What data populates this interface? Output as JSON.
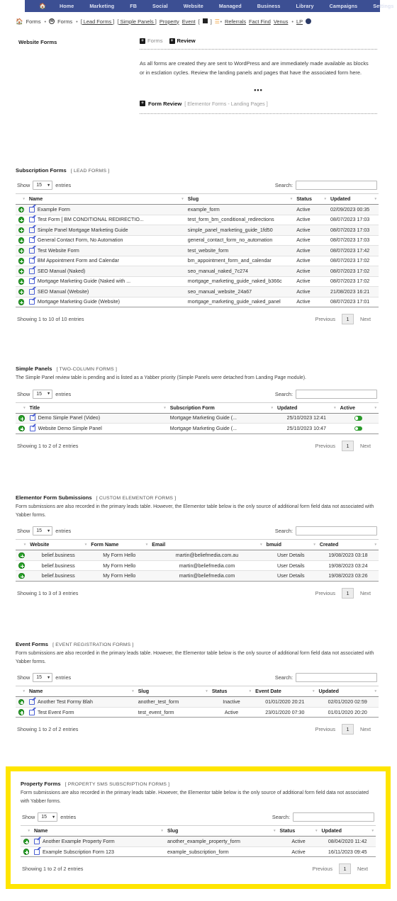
{
  "topnav": {
    "home_icon": "home-icon",
    "items": [
      "Home",
      "Marketing",
      "FB",
      "Social",
      "Website",
      "Managed",
      "Business",
      "Library",
      "Campaigns",
      "Settings"
    ],
    "bg_color": "#3c4f93"
  },
  "breadcrumb": {
    "home_icon": "home-icon",
    "item1": "Forms",
    "sep1": "•",
    "wp_icon": "wordpress-icon",
    "item2": "Forms",
    "sep2": "•",
    "item3": "[ Lead Forms ]",
    "item4": "[ Simple Panels ]",
    "item5": "Property",
    "item6": "Event",
    "item7_open": "[",
    "square_icon": "square-icon",
    "item7_close": "]",
    "list_icon": "list-icon",
    "sep3": "•",
    "item8": "Referrals",
    "item9": "Fact Find",
    "item10": "Venus",
    "sep4": "•",
    "item11": "LP",
    "moon_icon": "moon-icon"
  },
  "intro": {
    "label": "Website Forms",
    "tag_forms": "Forms",
    "tag_review": "Review",
    "paragraph": "As all forms are created they are sent to WordPress and are immediately made available as blocks or in esclation cycles. Review the landing panels and pages that have the associated form here.",
    "ellipsis": "•••",
    "review_title": "Form Review",
    "review_sub": "[ Elementor Forms  -  Landing Pages ]"
  },
  "controls": {
    "show_label": "Show",
    "entries_label": "entries",
    "page_size": "15",
    "search_label": "Search:",
    "search_value": "",
    "search_placeholder": ""
  },
  "pager": {
    "previous": "Previous",
    "page": "1",
    "next": "Next"
  },
  "sections": [
    {
      "title": "Subscription Forms",
      "tag": "[ LEAD FORMS ]",
      "desc": "",
      "columns": [
        "Name",
        "Slug",
        "Status",
        "Updated"
      ],
      "rows": [
        {
          "name": "Example Form",
          "slug": "example_form",
          "status": "Active",
          "updated": "02/09/2023 00:35"
        },
        {
          "name": "Test Form [ BM CONDITIONAL REDIRECTIO...",
          "slug": "test_form_bm_conditional_redirections",
          "status": "Active",
          "updated": "08/07/2023 17:03"
        },
        {
          "name": "Simple Panel Mortgage Marketing Guide",
          "slug": "simple_panel_marketing_guide_1fd50",
          "status": "Active",
          "updated": "08/07/2023 17:03"
        },
        {
          "name": "General Contact Form, No Automation",
          "slug": "general_contact_form_no_automation",
          "status": "Active",
          "updated": "08/07/2023 17:03"
        },
        {
          "name": "Test Website Form",
          "slug": "test_website_form",
          "status": "Active",
          "updated": "08/07/2023 17:42"
        },
        {
          "name": "BM Appointment Form and Calendar",
          "slug": "bm_appointment_form_and_calendar",
          "status": "Active",
          "updated": "08/07/2023 17:02"
        },
        {
          "name": "SEO Manual (Naked)",
          "slug": "seo_manual_naked_7c274",
          "status": "Active",
          "updated": "08/07/2023 17:02"
        },
        {
          "name": "Mortgage Marketing Guide (Naked with ...",
          "slug": "mortgage_marketing_guide_naked_b366c",
          "status": "Active",
          "updated": "08/07/2023 17:02"
        },
        {
          "name": "SEO Manual (Website)",
          "slug": "seo_manual_website_24a67",
          "status": "Active",
          "updated": "21/08/2023 16:21"
        },
        {
          "name": "Mortgage Marketing Guide (Website)",
          "slug": "mortgage_marketing_guide_naked_panel",
          "status": "Active",
          "updated": "08/07/2023 17:01"
        }
      ],
      "showing": "Showing 1 to 10 of 10 entries"
    },
    {
      "title": "Simple Panels",
      "tag": "[ TWO-COLUMN FORMS ]",
      "desc": "The Simple Panel review table is pending and is listed as a Yabber priority (Simple Panels were detached from Landing Page module).",
      "columns": [
        "Title",
        "Subscription Form",
        "Updated",
        "Active"
      ],
      "rows": [
        {
          "title": "Demo Simple Panel (Video)",
          "subscription_form": "Mortgage Marketing Guide (...",
          "updated": "25/10/2023 12:41",
          "active": true
        },
        {
          "title": "Website Demo Simple Panel",
          "subscription_form": "Mortgage Marketing Guide (...",
          "updated": "25/10/2023 10:47",
          "active": true
        }
      ],
      "showing": "Showing 1 to 2 of 2 entries"
    },
    {
      "title": "Elementor Form Submissions",
      "tag": "[ CUSTOM ELEMENTOR FORMS ]",
      "desc": "Form submissions are also recorded in the primary leads table. However, the Elementor table below is the only source of additional form field data not associated with Yabber forms.",
      "columns": [
        "Website",
        "Form Name",
        "Email",
        "bmuid",
        "Created"
      ],
      "rows": [
        {
          "website": "belief.business",
          "form_name": "My Form Hello",
          "email": "martin@beliefmedia.com.au",
          "bmuid": "User Details",
          "created": "19/08/2023 03:18"
        },
        {
          "website": "belief.business",
          "form_name": "My Form Hello",
          "email": "martin@beliefmedia.com",
          "bmuid": "User Details",
          "created": "19/08/2023 03:24"
        },
        {
          "website": "belief.business",
          "form_name": "My Form Hello",
          "email": "martin@beliefmedia.com",
          "bmuid": "User Details",
          "created": "19/08/2023 03:26"
        }
      ],
      "showing": "Showing 1 to 3 of 3 entries"
    },
    {
      "title": "Event Forms",
      "tag": "[ EVENT REGISTRATION FORMS ]",
      "desc": "Form submissions are also recorded in the primary leads table. However, the Elementor table below is the only source of additional form field data not associated with Yabber forms.",
      "columns": [
        "Name",
        "Slug",
        "Status",
        "Event Date",
        "Updated"
      ],
      "rows": [
        {
          "name": "Another Test Formy Blah",
          "slug": "another_test_form",
          "status": "Inactive",
          "event_date": "01/01/2020 20:21",
          "updated": "02/01/2020 02:59"
        },
        {
          "name": "Test Event Form",
          "slug": "test_event_form",
          "status": "Active",
          "event_date": "23/01/2020 07:30",
          "updated": "01/01/2020 20:20"
        }
      ],
      "showing": "Showing 1 to 2 of 2 entries"
    },
    {
      "title": "Property Forms",
      "tag": "[ PROPERTY SMS SUBSCRIPTION FORMS ]",
      "desc": "Form submissions are also recorded in the primary leads table. However, the Elementor table below is the only source of additional form field data not associated with Yabber forms.",
      "highlighted": true,
      "highlight_color": "#ffe500",
      "columns": [
        "Name",
        "Slug",
        "Status",
        "Updated"
      ],
      "rows": [
        {
          "name": "Another Example Property Form",
          "slug": "another_example_property_form",
          "status": "Active",
          "updated": "08/04/2020 11:42"
        },
        {
          "name": "Example Subscription Form 123",
          "slug": "example_subscription_form",
          "status": "Active",
          "updated": "16/11/2023 09:45"
        }
      ],
      "showing": "Showing 1 to 2 of 2 entries"
    }
  ]
}
